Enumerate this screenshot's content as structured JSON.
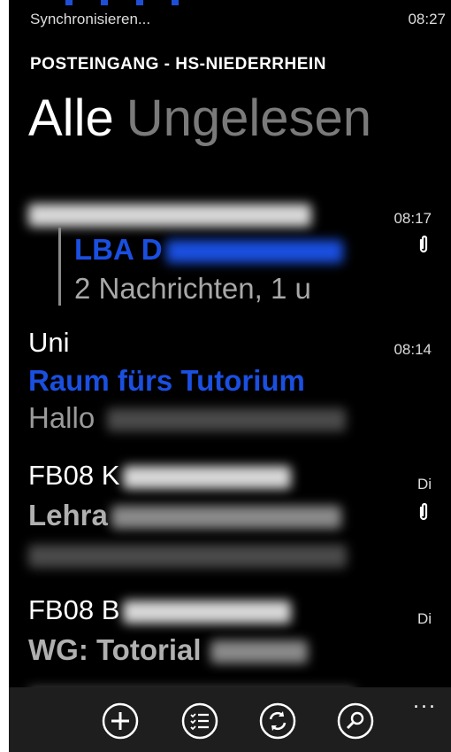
{
  "status": {
    "sync_text": "Synchronisieren...",
    "time": "08:27"
  },
  "account": {
    "title": "POSTEINGANG - HS-NIEDERRHEIN"
  },
  "pivot": {
    "active": "Alle",
    "inactive": "Ungelesen"
  },
  "messages": [
    {
      "sender": "",
      "subject": "LBA D",
      "preview": "2 Nachrichten, 1 u",
      "time": "08:17",
      "attachment": true
    },
    {
      "sender": "Uni",
      "subject": "Raum fürs Tutorium",
      "preview": "Hallo",
      "time": "08:14",
      "attachment": false
    },
    {
      "sender": "FB08 K",
      "subject": "Lehra",
      "preview": "",
      "time": "Di",
      "attachment": true
    },
    {
      "sender": "FB08 B",
      "subject": "WG: Totorial",
      "preview": "",
      "time": "Di",
      "attachment": false
    }
  ],
  "appbar": {
    "buttons": [
      "add-icon",
      "select-icon",
      "sync-icon",
      "search-icon"
    ],
    "more": "..."
  },
  "colors": {
    "accent": "#1a4fe0",
    "background": "#000000",
    "appbar": "#1e1e1e"
  }
}
